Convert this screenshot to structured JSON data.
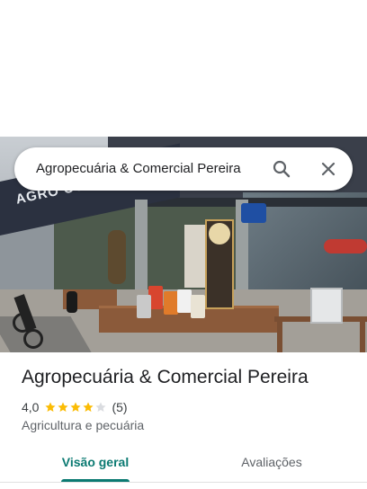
{
  "search": {
    "query": "Agropecuária & Comercial Pereira",
    "search_icon": "search-icon",
    "close_icon": "close-icon"
  },
  "photo": {
    "description_icon": "storefront-photo",
    "sign_text": "AGRO COMERCI"
  },
  "place": {
    "title": "Agropecuária & Comercial Pereira",
    "rating": "4,0",
    "stars_filled": 4,
    "stars_total": 5,
    "review_count": "(5)",
    "category": "Agricultura e pecuária"
  },
  "tabs": [
    {
      "label": "Visão geral",
      "active": true
    },
    {
      "label": "Avaliações",
      "active": false
    }
  ],
  "colors": {
    "accent": "#0b7a72",
    "star_filled": "#fbbc04",
    "star_empty": "#dadce0",
    "text_secondary": "#5f6368"
  }
}
